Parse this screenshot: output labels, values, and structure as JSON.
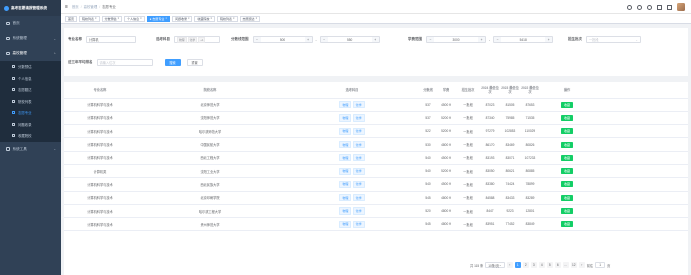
{
  "brand": {
    "title": "高考志愿填报管理系统"
  },
  "sidebar": {
    "items": [
      {
        "label": "首页",
        "icon": "dashboard-icon"
      },
      {
        "label": "系统管理",
        "icon": "gear-icon"
      },
      {
        "label": "高校管理",
        "icon": "school-icon"
      }
    ],
    "subitems": [
      {
        "label": "分数预估"
      },
      {
        "label": "个人信息"
      },
      {
        "label": "志愿题达"
      },
      {
        "label": "院校列表"
      },
      {
        "label": "志愿专业"
      },
      {
        "label": "问题收录"
      },
      {
        "label": "收藏院校"
      }
    ],
    "tools": {
      "label": "系统工具",
      "icon": "tool-icon"
    }
  },
  "breadcrumb": {
    "home": "首页",
    "section": "高校管理",
    "current": "志愿专业"
  },
  "tags": [
    {
      "label": "首页"
    },
    {
      "label": "院校列表"
    },
    {
      "label": "分数预估"
    },
    {
      "label": "个人信息"
    },
    {
      "label": "志愿专业"
    },
    {
      "label": "问题收录"
    },
    {
      "label": "收藏院校"
    },
    {
      "label": "院校列表"
    },
    {
      "label": "志愿题达"
    }
  ],
  "filters": {
    "major_label": "专业名称",
    "major_value": "计算机",
    "subject_label": "选考科目",
    "subject_chips": [
      "物理",
      "化学"
    ],
    "subject_more": "+1",
    "score_label": "分数线范围",
    "score_min": "500",
    "score_max": "550",
    "fee_label": "学费范围",
    "fee_min": "3000",
    "fee_max": "5418",
    "batch_label": "招生批次",
    "batch_placeholder": "一批段",
    "rank_label": "近三年平均排名",
    "rank_placeholder": "请输入位次",
    "search_btn": "搜索",
    "reset_btn": "重置"
  },
  "table": {
    "headers": [
      "专业名称",
      "院校名称",
      "选考科目",
      "分数线",
      "学费",
      "招生批次",
      "2024 最低位次",
      "2023 最低位次",
      "2022 最低位次",
      "操作"
    ],
    "rows": [
      {
        "major": "计算机科学与技术",
        "school": "北京师范大学",
        "subjects": [
          "物理",
          "化学"
        ],
        "score": "537",
        "fee": "4500 ¥",
        "batch": "一批段",
        "r2024": "87023",
        "r2023": "81505",
        "r2022": "87653",
        "action": "收藏"
      },
      {
        "major": "计算机科学与技术",
        "school": "沈阳师范大学",
        "subjects": [
          "物理",
          "化学"
        ],
        "score": "537",
        "fee": "5200 ¥",
        "batch": "一批段",
        "r2024": "87340",
        "r2023": "75985",
        "r2022": "71535",
        "action": "收藏"
      },
      {
        "major": "计算机科学与技术",
        "school": "哈尔滨师范大学",
        "subjects": [
          "物理",
          "化学"
        ],
        "score": "522",
        "fee": "5200 ¥",
        "batch": "一批段",
        "r2024": "97279",
        "r2023": "102853",
        "r2022": "110029",
        "action": "收藏"
      },
      {
        "major": "计算机科学与技术",
        "school": "中国民航大学",
        "subjects": [
          "物理",
          "化学"
        ],
        "score": "530",
        "fee": "4800 ¥",
        "batch": "一批段",
        "r2024": "86170",
        "r2023": "83469",
        "r2022": "80826",
        "action": "收藏"
      },
      {
        "major": "计算机科学与技术",
        "school": "西北工程大学",
        "subjects": [
          "物理",
          "化学"
        ],
        "score": "540",
        "fee": "4500 ¥",
        "batch": "一批段",
        "r2024": "83193",
        "r2023": "83071",
        "r2022": "107233",
        "action": "收藏"
      },
      {
        "major": "计算机类",
        "school": "沈阳工业大学",
        "subjects": [
          "物理",
          "化学"
        ],
        "score": "540",
        "fee": "5200 ¥",
        "batch": "一批段",
        "r2024": "83050",
        "r2023": "80621",
        "r2022": "80885",
        "action": "收藏"
      },
      {
        "major": "计算机科学与技术",
        "school": "西北民族大学",
        "subjects": [
          "物理",
          "化学"
        ],
        "score": "540",
        "fee": "4500 ¥",
        "batch": "一批段",
        "r2024": "83380",
        "r2023": "74424",
        "r2022": "78899",
        "action": "收藏"
      },
      {
        "major": "计算机科学与技术",
        "school": "北京印刷学院",
        "subjects": [
          "物理",
          "化学"
        ],
        "score": "545",
        "fee": "4800 ¥",
        "batch": "一批段",
        "r2024": "84588",
        "r2023": "83433",
        "r2022": "83289",
        "action": "收藏"
      },
      {
        "major": "计算机科学与技术",
        "school": "哈尔滨工程大学",
        "subjects": [
          "物理",
          "化学"
        ],
        "score": "520",
        "fee": "4800 ¥",
        "batch": "一批段",
        "r2024": "8447",
        "r2023": "9223",
        "r2022": "12801",
        "action": "收藏"
      },
      {
        "major": "计算机科学与技术",
        "school": "贵州师范大学",
        "subjects": [
          "物理",
          "化学"
        ],
        "score": "545",
        "fee": "4800 ¥",
        "batch": "一批段",
        "r2024": "83951",
        "r2023": "77452",
        "r2022": "83849",
        "action": "收藏"
      }
    ]
  },
  "pagination": {
    "total": "共 115 条",
    "page_size": "10条/页",
    "pages": [
      "1",
      "2",
      "3",
      "4",
      "5",
      "6",
      "...",
      "12"
    ],
    "current": "1",
    "goto_label": "前往",
    "goto_value": "1",
    "page_suffix": "页"
  }
}
